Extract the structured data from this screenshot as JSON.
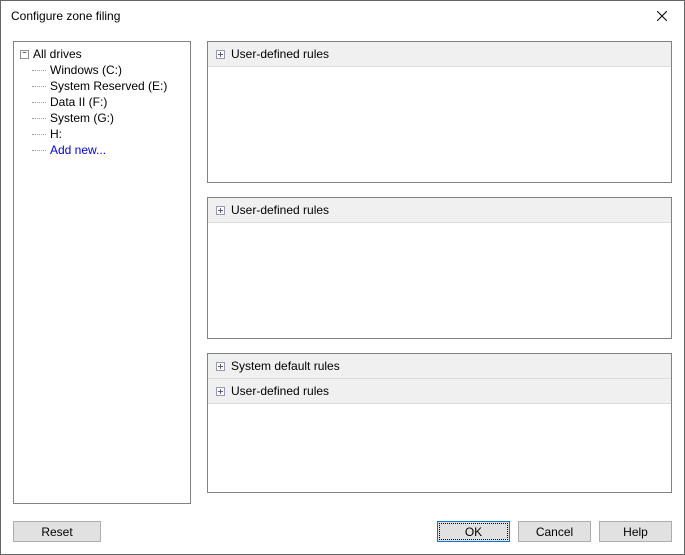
{
  "titlebar": {
    "title": "Configure zone filing"
  },
  "tree": {
    "root_label": "All drives",
    "items": [
      "Windows (C:)",
      "System Reserved (E:)",
      "Data II (F:)",
      "System (G:)",
      "H:"
    ],
    "add_new_label": "Add new..."
  },
  "panels": {
    "panel1": {
      "rules": [
        {
          "label": "User-defined rules"
        }
      ]
    },
    "panel2": {
      "rules": [
        {
          "label": "User-defined rules"
        }
      ]
    },
    "panel3": {
      "rules": [
        {
          "label": "System default rules"
        },
        {
          "label": "User-defined rules"
        }
      ]
    }
  },
  "buttons": {
    "reset": "Reset",
    "ok": "OK",
    "cancel": "Cancel",
    "help": "Help"
  }
}
